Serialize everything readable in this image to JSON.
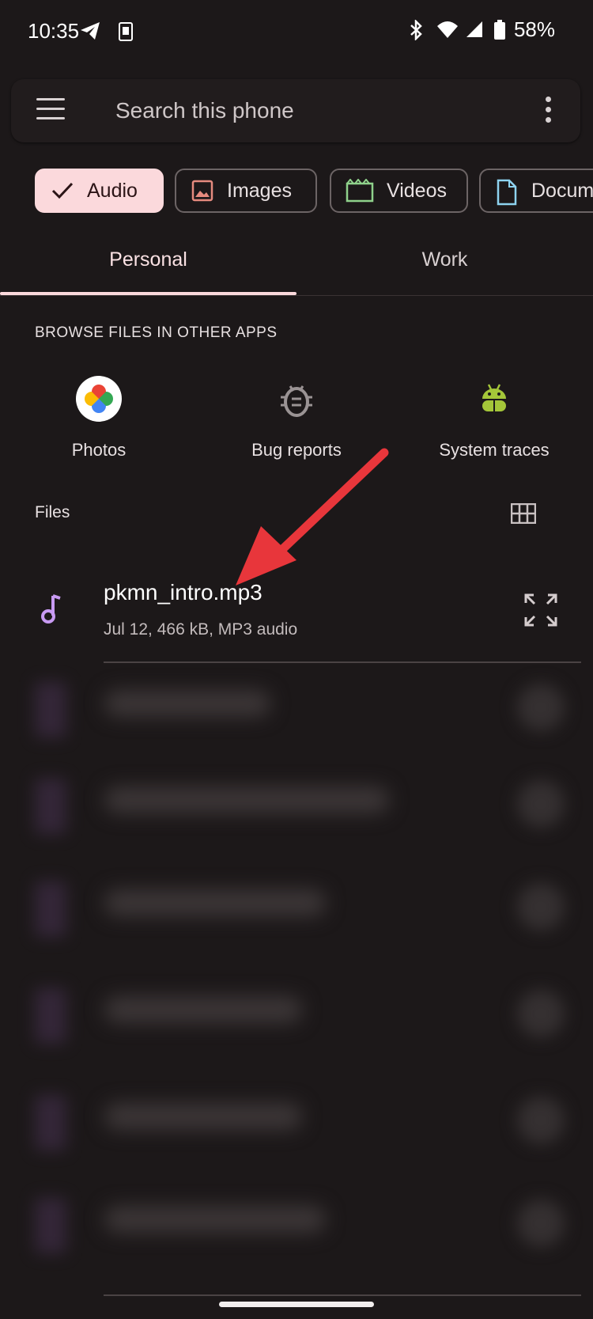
{
  "status_bar": {
    "time": "10:35",
    "battery": "58%"
  },
  "search": {
    "placeholder": "Search this phone"
  },
  "chips": [
    {
      "label": "Audio",
      "icon": "check-icon",
      "selected": true
    },
    {
      "label": "Images",
      "icon": "image-icon",
      "color": "#e58a7e"
    },
    {
      "label": "Videos",
      "icon": "video-icon",
      "color": "#8fd18b"
    },
    {
      "label": "Docum",
      "icon": "document-icon",
      "color": "#8ed3f0"
    }
  ],
  "tabs": [
    {
      "label": "Personal",
      "active": true
    },
    {
      "label": "Work",
      "active": false
    }
  ],
  "browse": {
    "title": "BROWSE FILES IN OTHER APPS",
    "apps": [
      {
        "label": "Photos",
        "icon": "google-photos-icon"
      },
      {
        "label": "Bug reports",
        "icon": "bug-icon"
      },
      {
        "label": "System traces",
        "icon": "android-icon"
      }
    ]
  },
  "files": {
    "title": "Files",
    "items": [
      {
        "name": "pkmn_intro.mp3",
        "meta": "Jul 12, 466 kB, MP3 audio",
        "icon": "music-note-icon"
      }
    ]
  },
  "colors": {
    "background": "#1c1819",
    "accent": "#fbd9dc",
    "arrow": "#e8363b",
    "audio_icon": "#c89af2"
  }
}
